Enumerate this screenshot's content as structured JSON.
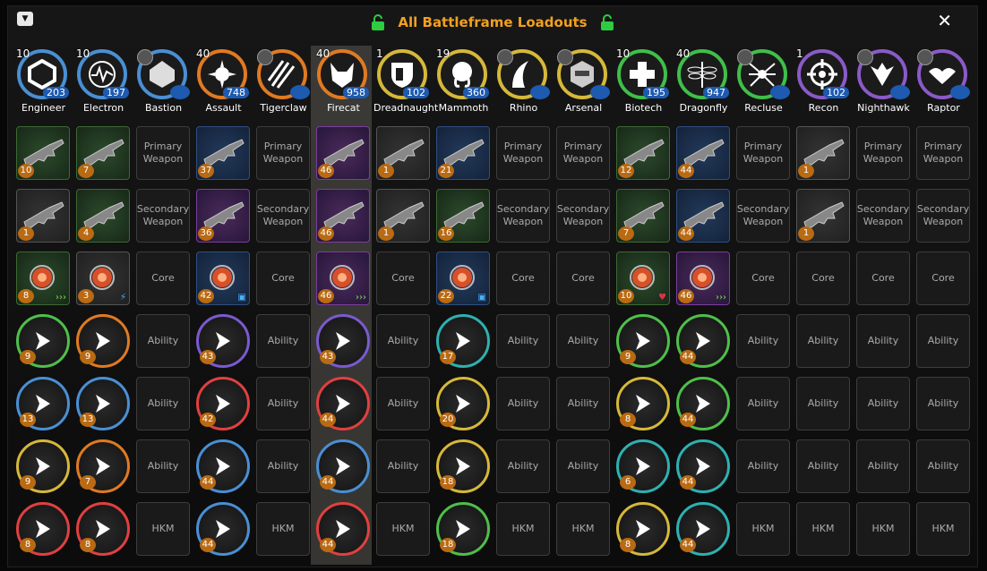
{
  "window": {
    "title": "All Battleframe Loadouts",
    "close": "✕",
    "menu": "▼"
  },
  "frames": [
    {
      "name": "Engineer",
      "level": "10",
      "count": "203",
      "ring": "#4a8fd4",
      "icon": "hex"
    },
    {
      "name": "Electron",
      "level": "10",
      "count": "197",
      "ring": "#4a8fd4",
      "icon": "wave"
    },
    {
      "name": "Bastion",
      "level": "",
      "count": "",
      "ring": "#4a8fd4",
      "icon": "shield-hex"
    },
    {
      "name": "Assault",
      "level": "40",
      "count": "748",
      "ring": "#e07a22",
      "icon": "burst"
    },
    {
      "name": "Tigerclaw",
      "level": "",
      "count": "",
      "ring": "#e07a22",
      "icon": "claw"
    },
    {
      "name": "Firecat",
      "level": "40",
      "count": "958",
      "ring": "#e07a22",
      "icon": "cat"
    },
    {
      "name": "Dreadnaught",
      "level": "1",
      "count": "102",
      "ring": "#d6b83a",
      "icon": "shield"
    },
    {
      "name": "Mammoth",
      "level": "19",
      "count": "360",
      "ring": "#d6b83a",
      "icon": "mammoth"
    },
    {
      "name": "Rhino",
      "level": "",
      "count": "",
      "ring": "#d6b83a",
      "icon": "horn"
    },
    {
      "name": "Arsenal",
      "level": "",
      "count": "",
      "ring": "#d6b83a",
      "icon": "robot"
    },
    {
      "name": "Biotech",
      "level": "10",
      "count": "195",
      "ring": "#3fbf4a",
      "icon": "cross"
    },
    {
      "name": "Dragonfly",
      "level": "40",
      "count": "947",
      "ring": "#3fbf4a",
      "icon": "dragonfly"
    },
    {
      "name": "Recluse",
      "level": "",
      "count": "",
      "ring": "#3fbf4a",
      "icon": "spider"
    },
    {
      "name": "Recon",
      "level": "1",
      "count": "102",
      "ring": "#8a5ac8",
      "icon": "target"
    },
    {
      "name": "Nighthawk",
      "level": "",
      "count": "",
      "ring": "#8a5ac8",
      "icon": "hawk"
    },
    {
      "name": "Raptor",
      "level": "",
      "count": "",
      "ring": "#8a5ac8",
      "icon": "bird"
    }
  ],
  "rows": {
    "primary": [
      {
        "t": "item",
        "q": "green",
        "lvl": "10"
      },
      {
        "t": "item",
        "q": "green",
        "lvl": "7"
      },
      {
        "t": "empty",
        "label": "Primary Weapon"
      },
      {
        "t": "item",
        "q": "blue",
        "lvl": "37"
      },
      {
        "t": "empty",
        "label": "Primary Weapon"
      },
      {
        "t": "item",
        "q": "purple",
        "lvl": "46"
      },
      {
        "t": "item",
        "q": "white",
        "lvl": "1"
      },
      {
        "t": "item",
        "q": "blue",
        "lvl": "21"
      },
      {
        "t": "empty",
        "label": "Primary Weapon"
      },
      {
        "t": "empty",
        "label": "Primary Weapon"
      },
      {
        "t": "item",
        "q": "green",
        "lvl": "12"
      },
      {
        "t": "item",
        "q": "blue",
        "lvl": "44"
      },
      {
        "t": "empty",
        "label": "Primary Weapon"
      },
      {
        "t": "item",
        "q": "white",
        "lvl": "1"
      },
      {
        "t": "empty",
        "label": "Primary Weapon"
      },
      {
        "t": "empty",
        "label": "Primary Weapon"
      }
    ],
    "secondary": [
      {
        "t": "item",
        "q": "white",
        "lvl": "1"
      },
      {
        "t": "item",
        "q": "green",
        "lvl": "4"
      },
      {
        "t": "empty",
        "label": "Secondary Weapon"
      },
      {
        "t": "item",
        "q": "purple",
        "lvl": "36"
      },
      {
        "t": "empty",
        "label": "Secondary Weapon"
      },
      {
        "t": "item",
        "q": "purple",
        "lvl": "46"
      },
      {
        "t": "item",
        "q": "white",
        "lvl": "1"
      },
      {
        "t": "item",
        "q": "green",
        "lvl": "16"
      },
      {
        "t": "empty",
        "label": "Secondary Weapon"
      },
      {
        "t": "empty",
        "label": "Secondary Weapon"
      },
      {
        "t": "item",
        "q": "green",
        "lvl": "7"
      },
      {
        "t": "item",
        "q": "blue",
        "lvl": "44"
      },
      {
        "t": "empty",
        "label": "Secondary Weapon"
      },
      {
        "t": "item",
        "q": "white",
        "lvl": "1"
      },
      {
        "t": "empty",
        "label": "Secondary Weapon"
      },
      {
        "t": "empty",
        "label": "Secondary Weapon"
      }
    ],
    "core": [
      {
        "t": "core",
        "q": "green",
        "lvl": "8",
        "mod": "›››"
      },
      {
        "t": "core",
        "q": "white",
        "lvl": "3",
        "mod": "⚡"
      },
      {
        "t": "empty",
        "label": "Core"
      },
      {
        "t": "core",
        "q": "blue",
        "lvl": "42",
        "mod": "▣"
      },
      {
        "t": "empty",
        "label": "Core"
      },
      {
        "t": "core",
        "q": "purple",
        "lvl": "46",
        "mod": "›››"
      },
      {
        "t": "empty",
        "label": "Core"
      },
      {
        "t": "core",
        "q": "blue",
        "lvl": "22",
        "mod": "▣"
      },
      {
        "t": "empty",
        "label": "Core"
      },
      {
        "t": "empty",
        "label": "Core"
      },
      {
        "t": "core",
        "q": "green",
        "lvl": "10",
        "mod": "♥"
      },
      {
        "t": "core",
        "q": "purple",
        "lvl": "46",
        "mod": "›››"
      },
      {
        "t": "empty",
        "label": "Core"
      },
      {
        "t": "empty",
        "label": "Core"
      },
      {
        "t": "empty",
        "label": "Core"
      },
      {
        "t": "empty",
        "label": "Core"
      }
    ],
    "ability1": [
      {
        "t": "ab",
        "ring": "#4fbf4a",
        "lvl": "9"
      },
      {
        "t": "ab",
        "ring": "#e07a22",
        "lvl": "9"
      },
      {
        "t": "empty",
        "label": "Ability"
      },
      {
        "t": "ab",
        "ring": "#7a5ad0",
        "lvl": "43"
      },
      {
        "t": "empty",
        "label": "Ability"
      },
      {
        "t": "ab",
        "ring": "#7a5ad0",
        "lvl": "43"
      },
      {
        "t": "empty",
        "label": "Ability"
      },
      {
        "t": "ab",
        "ring": "#2fb0b0",
        "lvl": "17"
      },
      {
        "t": "empty",
        "label": "Ability"
      },
      {
        "t": "empty",
        "label": "Ability"
      },
      {
        "t": "ab",
        "ring": "#4fbf4a",
        "lvl": "9"
      },
      {
        "t": "ab",
        "ring": "#4fbf4a",
        "lvl": "44"
      },
      {
        "t": "empty",
        "label": "Ability"
      },
      {
        "t": "empty",
        "label": "Ability"
      },
      {
        "t": "empty",
        "label": "Ability"
      },
      {
        "t": "empty",
        "label": "Ability"
      }
    ],
    "ability2": [
      {
        "t": "ab",
        "ring": "#4a8fd4",
        "lvl": "13"
      },
      {
        "t": "ab",
        "ring": "#4a8fd4",
        "lvl": "13"
      },
      {
        "t": "empty",
        "label": "Ability"
      },
      {
        "t": "ab",
        "ring": "#e04040",
        "lvl": "42"
      },
      {
        "t": "empty",
        "label": "Ability"
      },
      {
        "t": "ab",
        "ring": "#e04040",
        "lvl": "44"
      },
      {
        "t": "empty",
        "label": "Ability"
      },
      {
        "t": "ab",
        "ring": "#d6b83a",
        "lvl": "20"
      },
      {
        "t": "empty",
        "label": "Ability"
      },
      {
        "t": "empty",
        "label": "Ability"
      },
      {
        "t": "ab",
        "ring": "#d6b83a",
        "lvl": "8"
      },
      {
        "t": "ab",
        "ring": "#4fbf4a",
        "lvl": "44"
      },
      {
        "t": "empty",
        "label": "Ability"
      },
      {
        "t": "empty",
        "label": "Ability"
      },
      {
        "t": "empty",
        "label": "Ability"
      },
      {
        "t": "empty",
        "label": "Ability"
      }
    ],
    "ability3": [
      {
        "t": "ab",
        "ring": "#d6b83a",
        "lvl": "9"
      },
      {
        "t": "ab",
        "ring": "#e07a22",
        "lvl": "7"
      },
      {
        "t": "empty",
        "label": "Ability"
      },
      {
        "t": "ab",
        "ring": "#4a8fd4",
        "lvl": "44"
      },
      {
        "t": "empty",
        "label": "Ability"
      },
      {
        "t": "ab",
        "ring": "#4a8fd4",
        "lvl": "44"
      },
      {
        "t": "empty",
        "label": "Ability"
      },
      {
        "t": "ab",
        "ring": "#d6b83a",
        "lvl": "18"
      },
      {
        "t": "empty",
        "label": "Ability"
      },
      {
        "t": "empty",
        "label": "Ability"
      },
      {
        "t": "ab",
        "ring": "#2fb0b0",
        "lvl": "6"
      },
      {
        "t": "ab",
        "ring": "#2fb0b0",
        "lvl": "44"
      },
      {
        "t": "empty",
        "label": "Ability"
      },
      {
        "t": "empty",
        "label": "Ability"
      },
      {
        "t": "empty",
        "label": "Ability"
      },
      {
        "t": "empty",
        "label": "Ability"
      }
    ],
    "hkm": [
      {
        "t": "ab",
        "ring": "#e04040",
        "lvl": "8"
      },
      {
        "t": "ab",
        "ring": "#e04040",
        "lvl": "8"
      },
      {
        "t": "empty",
        "label": "HKM"
      },
      {
        "t": "ab",
        "ring": "#4a8fd4",
        "lvl": "44"
      },
      {
        "t": "empty",
        "label": "HKM"
      },
      {
        "t": "ab",
        "ring": "#e04040",
        "lvl": "44"
      },
      {
        "t": "empty",
        "label": "HKM"
      },
      {
        "t": "ab",
        "ring": "#4fbf4a",
        "lvl": "18"
      },
      {
        "t": "empty",
        "label": "HKM"
      },
      {
        "t": "empty",
        "label": "HKM"
      },
      {
        "t": "ab",
        "ring": "#d6b83a",
        "lvl": "8"
      },
      {
        "t": "ab",
        "ring": "#2fb0b0",
        "lvl": "44"
      },
      {
        "t": "empty",
        "label": "HKM"
      },
      {
        "t": "empty",
        "label": "HKM"
      },
      {
        "t": "empty",
        "label": "HKM"
      },
      {
        "t": "empty",
        "label": "HKM"
      }
    ]
  }
}
